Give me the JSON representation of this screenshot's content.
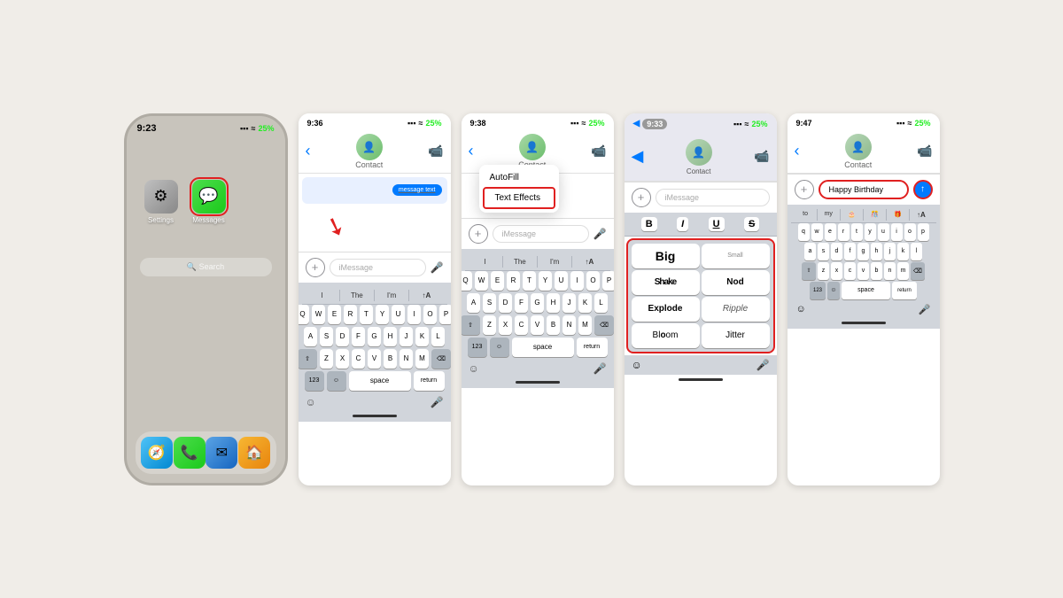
{
  "panels": {
    "panel1": {
      "time": "9:23",
      "icons": [
        {
          "name": "Settings",
          "type": "settings"
        },
        {
          "name": "Messages",
          "type": "messages",
          "highlighted": true
        }
      ],
      "searchLabel": "Search",
      "dock": [
        "Safari",
        "Phone",
        "Mail",
        "Home"
      ]
    },
    "panel2": {
      "time": "9:36",
      "hasArrow": true,
      "inputPlaceholder": "iMessage",
      "keys_row1": [
        "Q",
        "W",
        "E",
        "R",
        "T",
        "Y",
        "U",
        "I",
        "O",
        "P"
      ],
      "keys_row2": [
        "A",
        "S",
        "D",
        "F",
        "G",
        "H",
        "J",
        "K",
        "L"
      ],
      "keys_row3": [
        "Z",
        "X",
        "C",
        "V",
        "B",
        "N",
        "M"
      ],
      "suggestions": [
        "I",
        "The",
        "I'm",
        "↑A"
      ]
    },
    "panel3": {
      "time": "9:38",
      "popupItems": [
        "AutoFill",
        "Text Effects"
      ],
      "highlightedItem": "Text Effects",
      "inputPlaceholder": "iMessage",
      "suggestions": [
        "I",
        "The",
        "I'm",
        "↑A"
      ]
    },
    "panel4": {
      "time": "9:33",
      "inputPlaceholder": "iMessage",
      "formatButtons": [
        "B",
        "I",
        "U",
        "S"
      ],
      "effects": [
        {
          "label": "Big",
          "type": "big"
        },
        {
          "label": "Small",
          "type": "small"
        },
        {
          "label": "Shake",
          "type": "shake"
        },
        {
          "label": "Nod",
          "type": "nod"
        },
        {
          "label": "Explode",
          "type": "explode"
        },
        {
          "label": "Ripple",
          "type": "ripple"
        },
        {
          "label": "Bloom",
          "type": "bloom"
        },
        {
          "label": "Jitter",
          "type": "jitter"
        }
      ]
    },
    "panel5": {
      "time": "9:47",
      "messageText": "Happy Birthday",
      "keys_row1": [
        "q",
        "w",
        "e",
        "r",
        "t",
        "y",
        "u",
        "i",
        "o",
        "p"
      ],
      "keys_row2": [
        "a",
        "s",
        "d",
        "f",
        "g",
        "h",
        "j",
        "k",
        "l"
      ],
      "keys_row3": [
        "z",
        "x",
        "c",
        "v",
        "b",
        "n",
        "m"
      ],
      "suggestions": [
        "to",
        "my",
        "🎂",
        "🎊",
        "🎁",
        "↑A"
      ]
    }
  },
  "labels": {
    "autofill": "AutoFill",
    "textEffects": "Text Effects",
    "imessage": "iMessage",
    "search": "Search",
    "settings": "Settings",
    "messages": "Messages",
    "return": "return",
    "space": "space",
    "num123": "123",
    "bigEffect": "Big",
    "smallEffect": "Small",
    "shakeEffect": "Shake",
    "nodEffect": "Nod",
    "explodeEffect": "Explode",
    "rippleEffect": "Ripple",
    "bloomEffect": "Bloom",
    "jitterEffect": "Jitter",
    "happyBirthday": "Happy Birthday"
  }
}
